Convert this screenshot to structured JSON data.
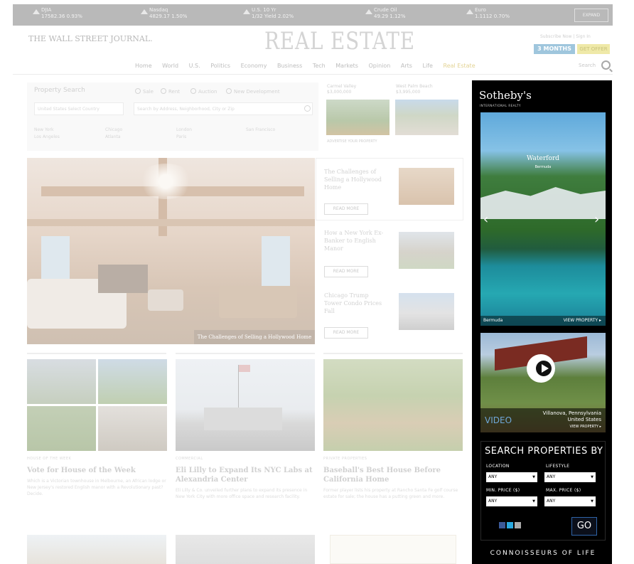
{
  "ticker": {
    "items": [
      {
        "name": "DJIA",
        "value": "17582.36",
        "change": "0.93%"
      },
      {
        "name": "Nasdaq",
        "value": "4829.17",
        "change": "1.50%"
      },
      {
        "name": "U.S. 10 Yr",
        "value": "1/32 Yield",
        "change": "2.02%"
      },
      {
        "name": "Crude Oil",
        "value": "49.29",
        "change": "1.12%"
      },
      {
        "name": "Euro",
        "value": "1.1112",
        "change": "0.70%"
      }
    ],
    "expand_label": "EXPAND"
  },
  "header": {
    "masthead": "THE WALL STREET JOURNAL.",
    "section_title": "REAL ESTATE",
    "subscribe_text": "Subscribe Now | Sign In",
    "promo": "3 MONTHS $12",
    "promo_offer": "GET OFFER"
  },
  "nav": {
    "items": [
      "Home",
      "World",
      "U.S.",
      "Politics",
      "Economy",
      "Business",
      "Tech",
      "Markets",
      "Opinion",
      "Arts",
      "Life",
      "Real Estate"
    ],
    "search_label": "Search"
  },
  "property_search": {
    "title": "Property Search",
    "options": [
      "Sale",
      "Rent",
      "Auction",
      "New Development"
    ],
    "country_placeholder": "United States Select Country",
    "location_placeholder": "Search by Address, Neighborhood, City or Zip",
    "cities": [
      [
        "New York",
        "Los Angeles"
      ],
      [
        "Chicago",
        "Atlanta"
      ],
      [
        "London",
        "Paris"
      ],
      [
        "San Francisco",
        ""
      ]
    ],
    "featured": [
      {
        "label": "Carmel Valley",
        "price": "$3,000,000"
      },
      {
        "label": "West Palm Beach",
        "price": "$3,995,000"
      }
    ],
    "advertise": "ADVERTISE YOUR PROPERTY"
  },
  "hero": {
    "caption": "The Challenges of Selling a Hollywood Home"
  },
  "side_stories": [
    {
      "title": "The Challenges of Selling a Hollywood Home",
      "button": "READ MORE"
    },
    {
      "title": "How a New York Ex-Banker to English Manor",
      "button": "READ MORE"
    },
    {
      "title": "Chicago Trump Tower Condo Prices Fall",
      "button": "READ MORE"
    }
  ],
  "cards": [
    {
      "kicker": "HOUSE OF THE WEEK",
      "title": "Vote for House of the Week",
      "text": "Which is a Victorian townhouse in Melbourne, an African lodge or New Jersey's restored English manor with a Revolutionary past? Decide."
    },
    {
      "kicker": "COMMERCIAL",
      "title": "Eli Lilly to Expand Its NYC Labs at Alexandria Center",
      "text": "Eli Lilly & Co. unveiled further plans to expand its presence in New York City with more office space and research facility."
    },
    {
      "kicker": "PRIVATE PROPERTIES",
      "title": "Baseball's Best House Before California Home",
      "text": "Former player lists his property at Rancho Santa Fe golf course estate for sale; the house has a putting green and more."
    }
  ],
  "ad": {
    "brand": "Sotheby's",
    "brand_sub": "INTERNATIONAL REALTY",
    "image1_title": "Waterford",
    "image1_sub": "Bermuda",
    "image1_location": "Bermuda",
    "view_property": "VIEW PROPERTY ▸",
    "video_label": "VIDEO",
    "video_location_1": "Villanova, Pennsylvania",
    "video_location_2": "United States",
    "search_title": "SEARCH PROPERTIES BY",
    "location_label": "LOCATION",
    "lifestyle_label": "LIFESTYLE",
    "min_price_label": "MIN. PRICE ($)",
    "max_price_label": "MAX. PRICE ($)",
    "any": "ANY",
    "go": "GO",
    "tagline": "CONNOISSEURS OF LIFE"
  }
}
